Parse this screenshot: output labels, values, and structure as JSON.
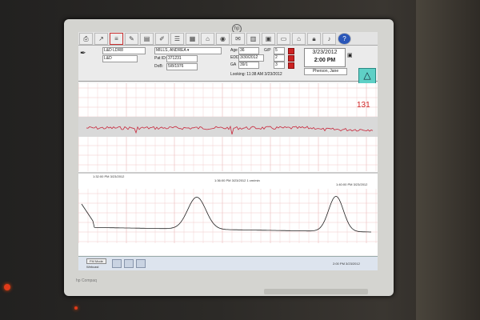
{
  "toolbar": {
    "icons": [
      "printer-icon",
      "arrow-icon",
      "fhr-view-icon",
      "annotate-icon",
      "chart-icon",
      "edit-icon",
      "list-icon",
      "grid-icon",
      "home-icon",
      "bottle-icon",
      "notes-icon",
      "table-icon",
      "tiles-icon",
      "vehicle-icon",
      "house-icon",
      "lock-icon",
      "speaker-icon",
      "help-icon"
    ]
  },
  "patient": {
    "bed": "L&D LDR8",
    "unit": "L&D",
    "name": "MILLS, ANDREA",
    "pat_id_label": "Pat ID:",
    "pat_id": "371231",
    "dob_label": "DoB:",
    "dob": "5/8/1976",
    "age_label": "Age",
    "age": "36",
    "edd_label": "EDD",
    "edd": "3/30/2012",
    "ga_label": "GA",
    "ga": "39/1",
    "gp_label": "G/P",
    "gp": "5",
    "p2": "2",
    "p3": "3",
    "looking": "Looking: 11:38 AM 3/23/2012",
    "date": "3/23/2012",
    "time": "2:00 PM",
    "clinician": "Pherson, Jane"
  },
  "strip": {
    "fhr_value": "131",
    "time_left": "1:32:00 PM 3/23/2012",
    "time_mid": "1:36:00 PM 3/23/2012  1 cm/min",
    "time_right": "1:40:00 PM 3/23/2012"
  },
  "statusbar": {
    "mode": "FM Mode",
    "sub": "Webcast",
    "clock": "2:00 PM 3/23/2012"
  }
}
